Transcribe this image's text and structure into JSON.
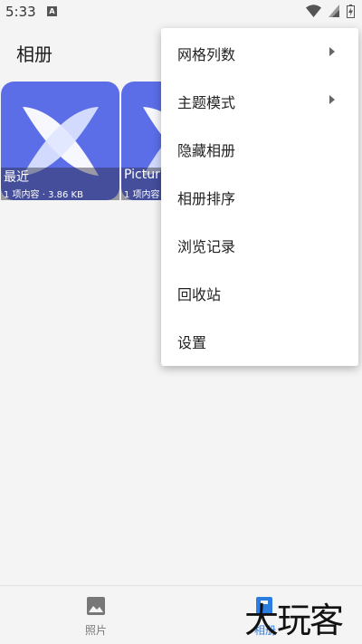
{
  "status_bar": {
    "time": "5:33",
    "notification_icon": "A"
  },
  "app_bar": {
    "title": "相册"
  },
  "albums": [
    {
      "name": "最近",
      "meta": "1 项内容 · 3.86 KB"
    },
    {
      "name": "Pictur",
      "meta": "1 项内容"
    }
  ],
  "menu": {
    "items": [
      {
        "label": "网格列数",
        "has_submenu": true
      },
      {
        "label": "主题模式",
        "has_submenu": true
      },
      {
        "label": "隐藏相册"
      },
      {
        "label": "相册排序"
      },
      {
        "label": "浏览记录"
      },
      {
        "label": "回收站"
      },
      {
        "label": "设置"
      }
    ]
  },
  "bottom_nav": {
    "photos": {
      "label": "照片",
      "icon": "image-icon"
    },
    "albums": {
      "label": "相册",
      "icon": "album-icon",
      "active": true
    }
  },
  "watermark": {
    "text": "大玩客"
  },
  "colors": {
    "accent": "#2b7de1",
    "thumb": "#5b6ee8",
    "background": "#f4f4f4"
  }
}
